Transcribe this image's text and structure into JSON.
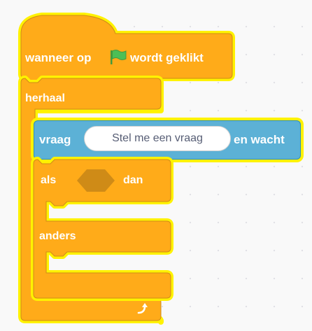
{
  "hat_block": {
    "text_before": "wanneer op",
    "icon": "green-flag-icon",
    "text_after": "wordt geklikt"
  },
  "repeat_block": {
    "label": "herhaal"
  },
  "ask_block": {
    "label": "vraag",
    "input_value": "Stel me een vraag",
    "suffix": "en wacht"
  },
  "if_else_block": {
    "if_label": "als",
    "then_label": "dan",
    "else_label": "anders"
  },
  "colors": {
    "control": "#ffab19",
    "events": "#ffbf00",
    "sensing": "#5cb1d6",
    "highlight": "#fff200"
  }
}
